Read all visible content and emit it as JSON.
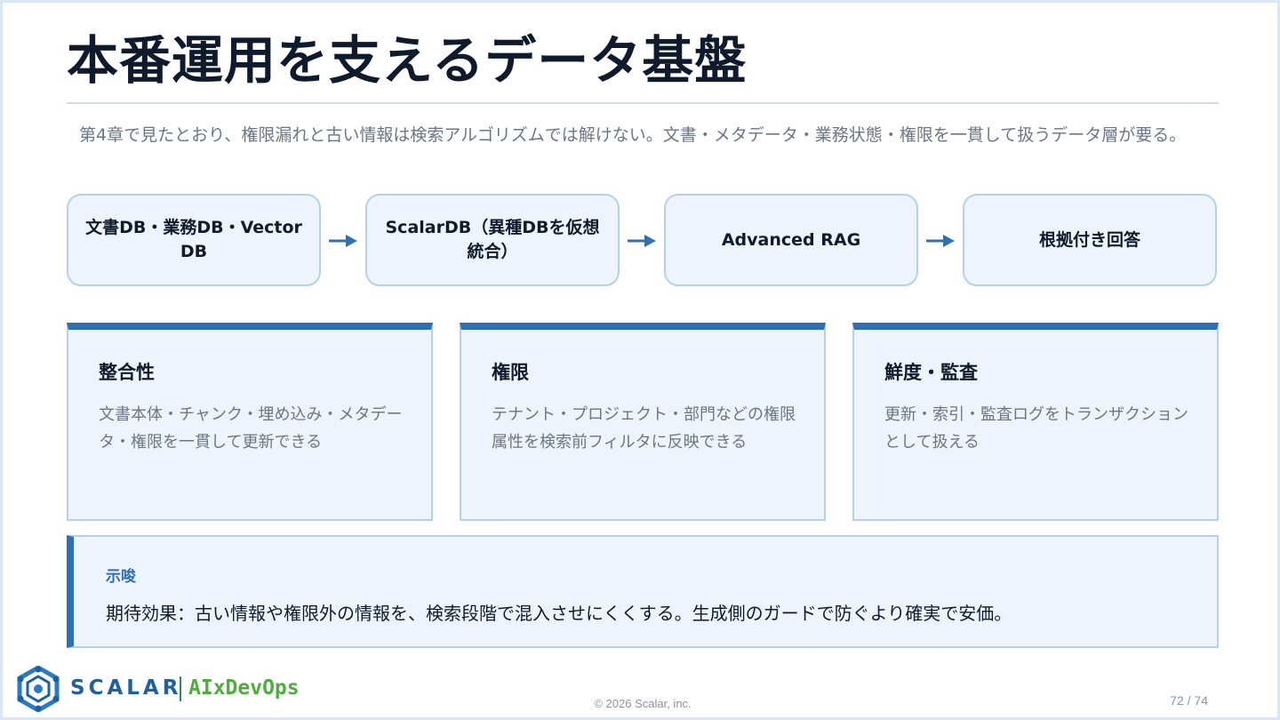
{
  "title": "本番運用を支えるデータ基盤",
  "intro": "第4章で見たとおり、権限漏れと古い情報は検索アルゴリズムでは解けない。文書・メタデータ・業務状態・権限を一貫して扱うデータ層が要る。",
  "flow": [
    {
      "label": "文書DB・業務DB・Vector DB"
    },
    {
      "label": "ScalarDB（異種DBを仮想統合）"
    },
    {
      "label": "Advanced RAG"
    },
    {
      "label": "根拠付き回答"
    }
  ],
  "cards": [
    {
      "title": "整合性",
      "body": "文書本体・チャンク・埋め込み・メタデータ・権限を一貫して更新できる"
    },
    {
      "title": "権限",
      "body": "テナント・プロジェクト・部門などの権限属性を検索前フィルタに反映できる"
    },
    {
      "title": "鮮度・監査",
      "body": "更新・索引・監査ログをトランザクションとして扱える"
    }
  ],
  "note": {
    "label": "示唆",
    "text": "期待効果：古い情報や権限外の情報を、検索段階で混入させにくくする。生成側のガードで防ぐより確実で安価。"
  },
  "footer": {
    "brand": "SCALAR",
    "product": "AIxDevOps",
    "copyright": "© 2026 Scalar, inc.",
    "page": "72 / 74"
  },
  "colors": {
    "accent": "#2e6fb5",
    "box_fill": "#eef4fb",
    "box_border": "#b7d0ea",
    "text_dark": "#0f1b2d",
    "text_muted": "#6b7684",
    "brand_blue": "#1f5fa3",
    "brand_green": "#4cae3c"
  },
  "icons": {
    "flow_arrow": "arrow-right-icon",
    "logo": "scalar-logo-icon"
  }
}
